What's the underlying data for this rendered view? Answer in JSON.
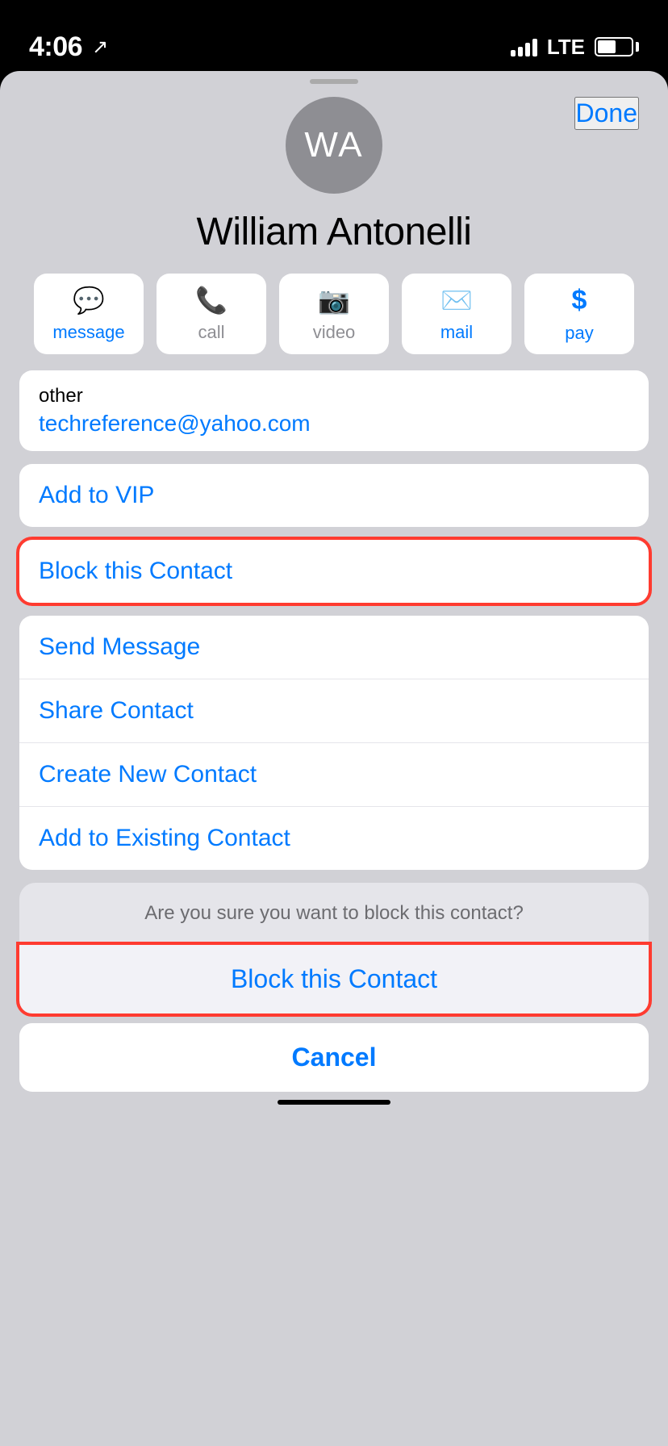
{
  "statusBar": {
    "time": "4:06",
    "lte": "LTE"
  },
  "header": {
    "doneLabel": "Done"
  },
  "contact": {
    "initials": "WA",
    "name": "William Antonelli"
  },
  "actionButtons": [
    {
      "id": "message",
      "label": "message",
      "active": true
    },
    {
      "id": "call",
      "label": "call",
      "active": false
    },
    {
      "id": "video",
      "label": "video",
      "active": false
    },
    {
      "id": "mail",
      "label": "mail",
      "active": true
    },
    {
      "id": "pay",
      "label": "pay",
      "active": true
    }
  ],
  "emailInfo": {
    "label": "other",
    "value": "techreference@yahoo.com"
  },
  "menuItems": {
    "addToVIP": "Add to VIP",
    "blockContact": "Block this Contact",
    "sendMessage": "Send Message",
    "shareContact": "Share Contact",
    "createNewContact": "Create New Contact",
    "addToExisting": "Add to Existing Contact"
  },
  "actionSheet": {
    "confirmMessage": "Are you sure you want to block this contact?",
    "confirmLabel": "Block this Contact",
    "cancelLabel": "Cancel"
  }
}
